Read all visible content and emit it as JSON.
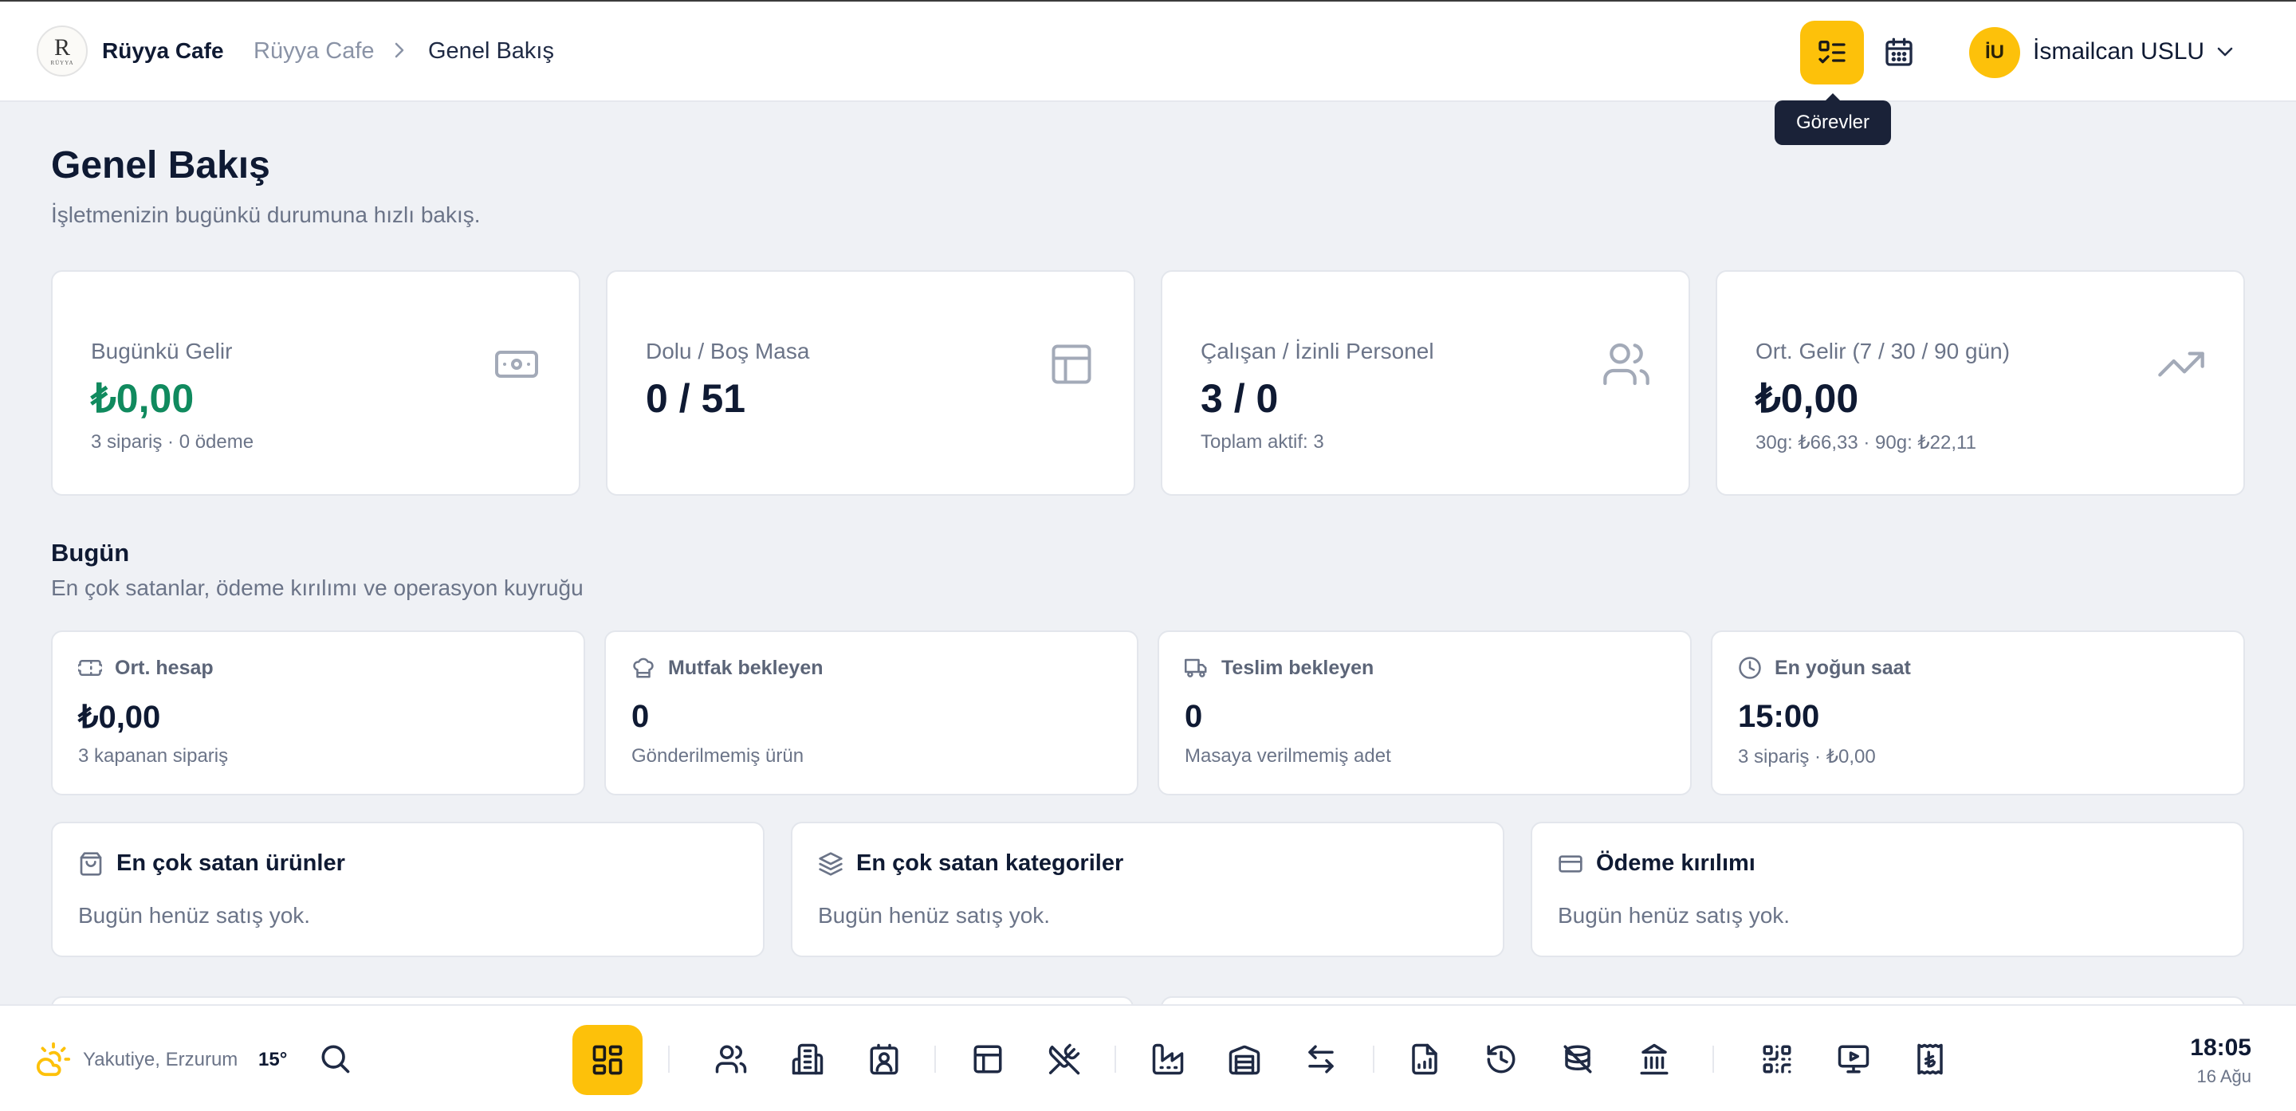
{
  "header": {
    "logo_initial": "R",
    "logo_text": "RÜYYA",
    "brand": "Rüyya Cafe",
    "breadcrumb": [
      "Rüyya Cafe",
      "Genel Bakış"
    ],
    "tooltip": "Görevler",
    "user_initials": "İU",
    "user_name": "İsmailcan USLU"
  },
  "page": {
    "title": "Genel Bakış",
    "subtitle": "İşletmenizin bugünkü durumuna hızlı bakış."
  },
  "kpis": [
    {
      "label": "Bugünkü Gelir",
      "value": "₺0,00",
      "sub": "3 sipariş · 0 ödeme",
      "icon": "banknote-icon"
    },
    {
      "label": "Dolu / Boş Masa",
      "value": "0 / 51",
      "sub": "",
      "icon": "table-layout-icon"
    },
    {
      "label": "Çalışan / İzinli Personel",
      "value": "3 / 0",
      "sub": "Toplam aktif: 3",
      "icon": "users-icon"
    },
    {
      "label": "Ort. Gelir (7 / 30 / 90 gün)",
      "value": "₺0,00",
      "sub": "30g: ₺66,33 · 90g: ₺22,11",
      "icon": "trending-up-icon"
    }
  ],
  "today": {
    "title": "Bugün",
    "subtitle": "En çok satanlar, ödeme kırılımı ve operasyon kuyruğu"
  },
  "metrics": [
    {
      "label": "Ort. hesap",
      "value": "₺0,00",
      "sub": "3 kapanan sipariş",
      "icon": "ticket-icon"
    },
    {
      "label": "Mutfak bekleyen",
      "value": "0",
      "sub": "Gönderilmemiş ürün",
      "icon": "chef-hat-icon"
    },
    {
      "label": "Teslim bekleyen",
      "value": "0",
      "sub": "Masaya verilmemiş adet",
      "icon": "truck-icon"
    },
    {
      "label": "En yoğun saat",
      "value": "15:00",
      "sub": "3 sipariş · ₺0,00",
      "icon": "clock-icon"
    }
  ],
  "panels": [
    {
      "title": "En çok satan ürünler",
      "empty": "Bugün henüz satış yok.",
      "icon": "shopping-bag-icon"
    },
    {
      "title": "En çok satan kategoriler",
      "empty": "Bugün henüz satış yok.",
      "icon": "layers-icon"
    },
    {
      "title": "Ödeme kırılımı",
      "empty": "Bugün henüz satış yok.",
      "icon": "credit-card-icon"
    }
  ],
  "dock": {
    "weather_location": "Yakutiye, Erzurum",
    "weather_temp": "15°",
    "time": "18:05",
    "date": "16 Ağu"
  },
  "colors": {
    "accent": "#fdc10a",
    "positive": "#108a5e",
    "text": "#0f1a33",
    "muted": "#6b7488",
    "background": "#eff1f5"
  }
}
